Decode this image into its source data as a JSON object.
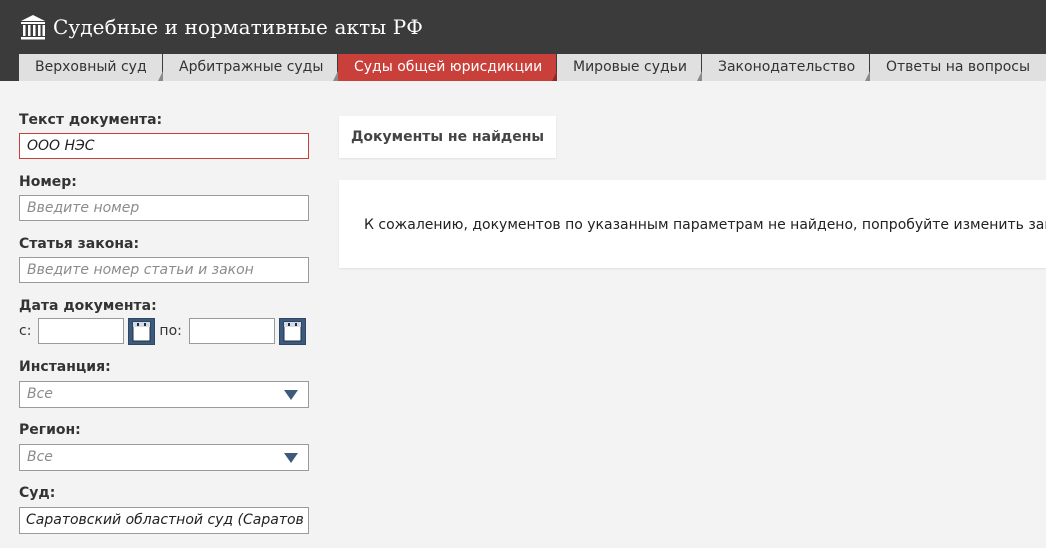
{
  "header": {
    "site_title": "Судебные и нормативные акты РФ",
    "logo_icon": "courthouse-icon"
  },
  "tabs": [
    {
      "label": "Верховный суд",
      "active": false
    },
    {
      "label": "Арбитражные суды",
      "active": false
    },
    {
      "label": "Суды общей юрисдикции",
      "active": true
    },
    {
      "label": "Мировые судьи",
      "active": false
    },
    {
      "label": "Законодательство",
      "active": false
    },
    {
      "label": "Ответы на вопросы",
      "active": false
    }
  ],
  "form": {
    "document_text": {
      "label": "Текст документа:",
      "value": "ООО НЭС"
    },
    "number": {
      "label": "Номер:",
      "placeholder": "Введите номер"
    },
    "law_article": {
      "label": "Статья закона:",
      "placeholder": "Введите номер статьи и закон"
    },
    "document_date": {
      "label": "Дата документа:",
      "from_label": "с:",
      "to_label": "по:",
      "from_value": "",
      "to_value": ""
    },
    "instance": {
      "label": "Инстанция:",
      "value": "Все"
    },
    "region": {
      "label": "Регион:",
      "value": "Все"
    },
    "court": {
      "label": "Суд:",
      "value": "Саратовский областной суд (Саратов"
    }
  },
  "results": {
    "title": "Документы не найдены",
    "message": "К сожалению, документов по указанным параметрам не найдено, попробуйте изменить запрос."
  },
  "colors": {
    "header_bg": "#3b3b3b",
    "active_tab": "#c9403b",
    "tab_bg": "#e0e0e0",
    "calendar_button": "#3d5a7d",
    "page_bg": "#f3f3f3"
  }
}
